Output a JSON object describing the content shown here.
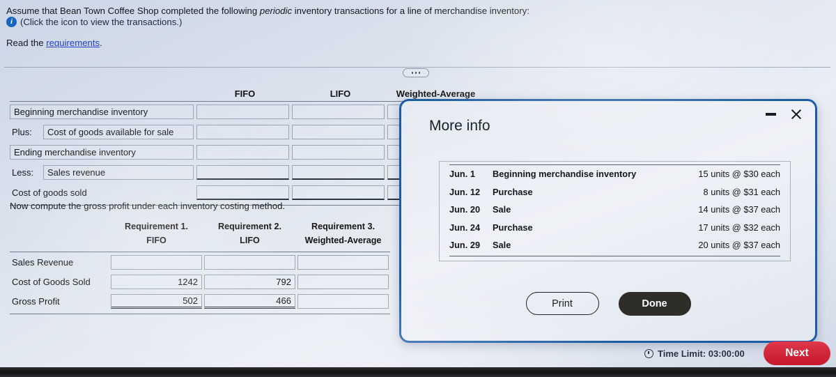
{
  "intro": {
    "line1_a": "Assume that Bean Town Coffee Shop completed the following ",
    "line1_em": "periodic",
    "line1_b": " inventory transactions for a line of merchandise inventory:",
    "line2": "(Click the icon to view the transactions.)",
    "line3_a": "Read the ",
    "line3_link": "requirements",
    "line3_b": "."
  },
  "table1": {
    "columns": [
      "FIFO",
      "LIFO",
      "Weighted-Average"
    ],
    "rows": [
      {
        "prefix": "",
        "label": "Beginning merchandise inventory",
        "type": "select-full",
        "values": [
          "",
          "",
          ""
        ]
      },
      {
        "prefix": "Plus:",
        "label": "Cost of goods available for sale",
        "type": "select-indent",
        "values": [
          "",
          "",
          ""
        ]
      },
      {
        "prefix": "",
        "label": "Ending merchandise inventory",
        "type": "select-full",
        "values": [
          "",
          "",
          ""
        ]
      },
      {
        "prefix": "Less:",
        "label": "Sales revenue",
        "type": "select-indent",
        "values": [
          "",
          "",
          ""
        ]
      },
      {
        "prefix": "",
        "label": "Cost of goods sold",
        "type": "plain",
        "values": [
          "",
          "",
          ""
        ]
      }
    ]
  },
  "mid_sentence": "Now compute the gross profit under each inventory costing method.",
  "table2": {
    "req_headers": [
      "Requirement 1.",
      "Requirement 2.",
      "Requirement 3."
    ],
    "method_headers": [
      "FIFO",
      "LIFO",
      "Weighted-Average"
    ],
    "rows": [
      {
        "label": "Sales Revenue",
        "values": [
          "",
          "",
          ""
        ],
        "double_rule": false
      },
      {
        "label": "Cost of Goods Sold",
        "values": [
          "1242",
          "792",
          ""
        ],
        "double_rule": false
      },
      {
        "label": "Gross Profit",
        "values": [
          "502",
          "466",
          ""
        ],
        "double_rule": true
      }
    ]
  },
  "modal": {
    "title": "More info",
    "transactions": [
      {
        "date": "Jun. 1",
        "description": "Beginning merchandise inventory",
        "quantity": "15 units @ $30 each"
      },
      {
        "date": "Jun. 12",
        "description": "Purchase",
        "quantity": "8 units @ $31 each"
      },
      {
        "date": "Jun. 20",
        "description": "Sale",
        "quantity": "14 units @ $37 each"
      },
      {
        "date": "Jun. 24",
        "description": "Purchase",
        "quantity": "17 units @ $32 each"
      },
      {
        "date": "Jun. 29",
        "description": "Sale",
        "quantity": "20 units @ $37 each"
      }
    ],
    "print_label": "Print",
    "done_label": "Done"
  },
  "footer": {
    "time_limit": "Time Limit: 03:00:00",
    "next_label": "Next"
  },
  "colors": {
    "modal_border": "#1c5ca6",
    "link": "#2341c8",
    "info_icon": "#1565c0",
    "next_button": "#c4182c",
    "done_button": "#2f2d28"
  }
}
